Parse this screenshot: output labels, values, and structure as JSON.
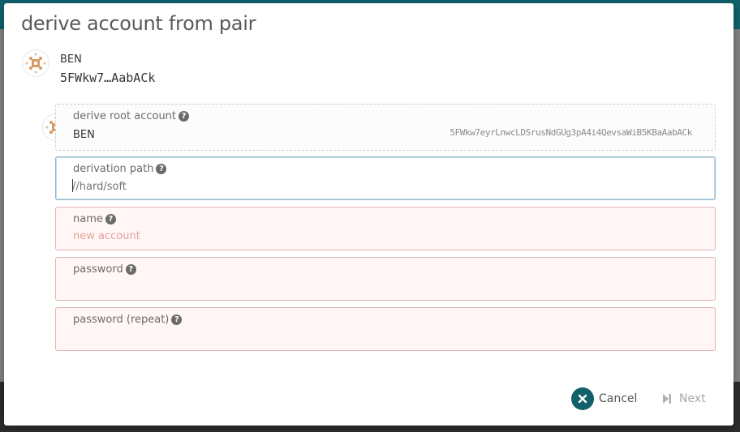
{
  "dialog": {
    "title": "derive account from pair"
  },
  "source_account": {
    "name": "BEN",
    "address_short": "5FWkw7…AabACk"
  },
  "root_account_field": {
    "label": "derive root account",
    "name": "BEN",
    "address": "5FWkw7eyrLnwcLDSrusNdGUg3pA4i4QevsaWiB5KBaAabACk"
  },
  "derivation_path_field": {
    "label": "derivation path",
    "placeholder": "//hard/soft",
    "value": ""
  },
  "name_field": {
    "label": "name",
    "placeholder": "new account"
  },
  "password_field": {
    "label": "password"
  },
  "password_repeat_field": {
    "label": "password (repeat)"
  },
  "actions": {
    "cancel_label": "Cancel",
    "next_label": "Next"
  },
  "help_glyph": "?",
  "colors": {
    "accent": "#11606a",
    "error_bg": "#fff6f5",
    "error_border": "#e0b4b4",
    "identicon_fill": "#d69b62"
  }
}
